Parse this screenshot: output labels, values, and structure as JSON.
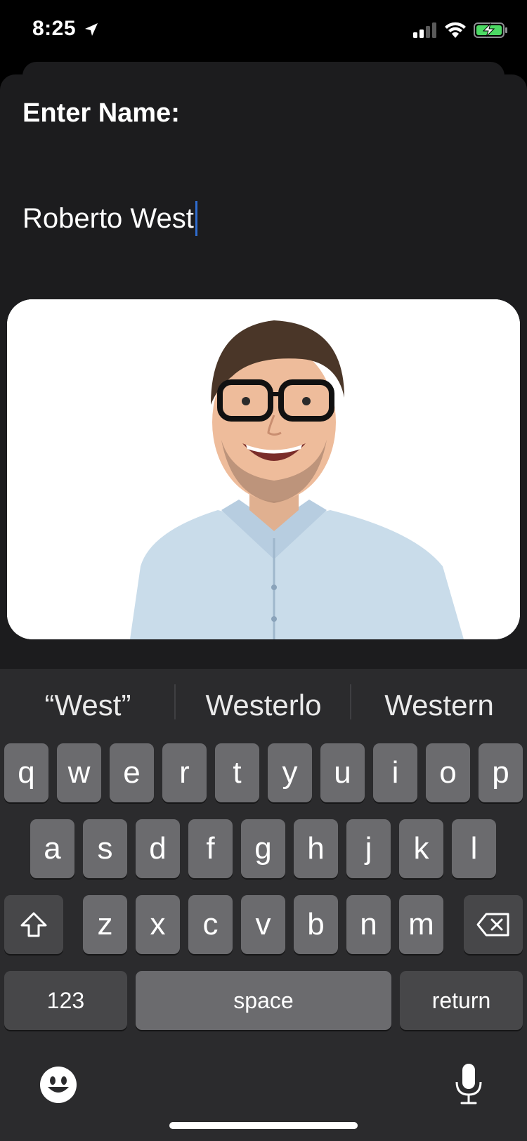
{
  "status_bar": {
    "time": "8:25"
  },
  "form": {
    "title": "Enter Name:",
    "name_value": "Roberto West"
  },
  "photo": {
    "description": "smiling-man-with-glasses-photo"
  },
  "keyboard": {
    "suggestions": [
      "“West”",
      "Westerlo",
      "Western"
    ],
    "row1": [
      "q",
      "w",
      "e",
      "r",
      "t",
      "y",
      "u",
      "i",
      "o",
      "p"
    ],
    "row2": [
      "a",
      "s",
      "d",
      "f",
      "g",
      "h",
      "j",
      "k",
      "l"
    ],
    "row3": [
      "z",
      "x",
      "c",
      "v",
      "b",
      "n",
      "m"
    ],
    "numbers_label": "123",
    "space_label": "space",
    "return_label": "return"
  },
  "colors": {
    "caret": "#2f6ccf",
    "sheet": "#1c1c1e",
    "keyboard": "#2b2b2d"
  }
}
